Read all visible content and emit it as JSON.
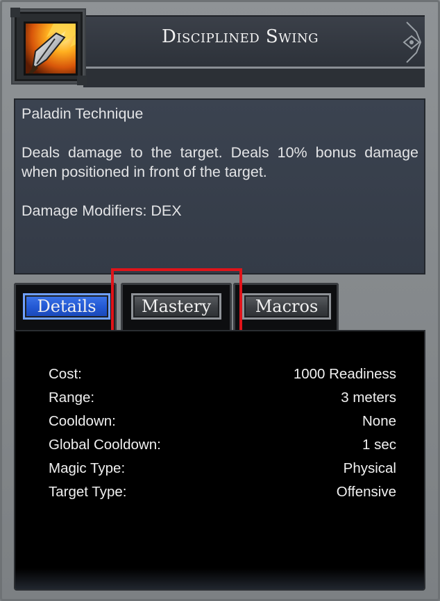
{
  "header": {
    "title": "Disciplined Swing",
    "icon": "flaming-blade-icon"
  },
  "description": {
    "type": "Paladin Technique",
    "text": "Deals damage to the target. Deals 10% bonus damage when positioned in front of the target.",
    "modifiers": "Damage Modifiers: DEX"
  },
  "tabs": [
    {
      "label": "Details",
      "active": true
    },
    {
      "label": "Mastery",
      "active": false
    },
    {
      "label": "Macros",
      "active": false
    }
  ],
  "details": [
    {
      "label": "Cost:",
      "value": "1000 Readiness"
    },
    {
      "label": "Range:",
      "value": "3 meters"
    },
    {
      "label": "Cooldown:",
      "value": "None"
    },
    {
      "label": "Global Cooldown:",
      "value": "1 sec"
    },
    {
      "label": "Magic Type:",
      "value": "Physical"
    },
    {
      "label": "Target Type:",
      "value": "Offensive"
    }
  ],
  "colors": {
    "highlight": "#e0141a",
    "active_tab": "#2258d3"
  }
}
